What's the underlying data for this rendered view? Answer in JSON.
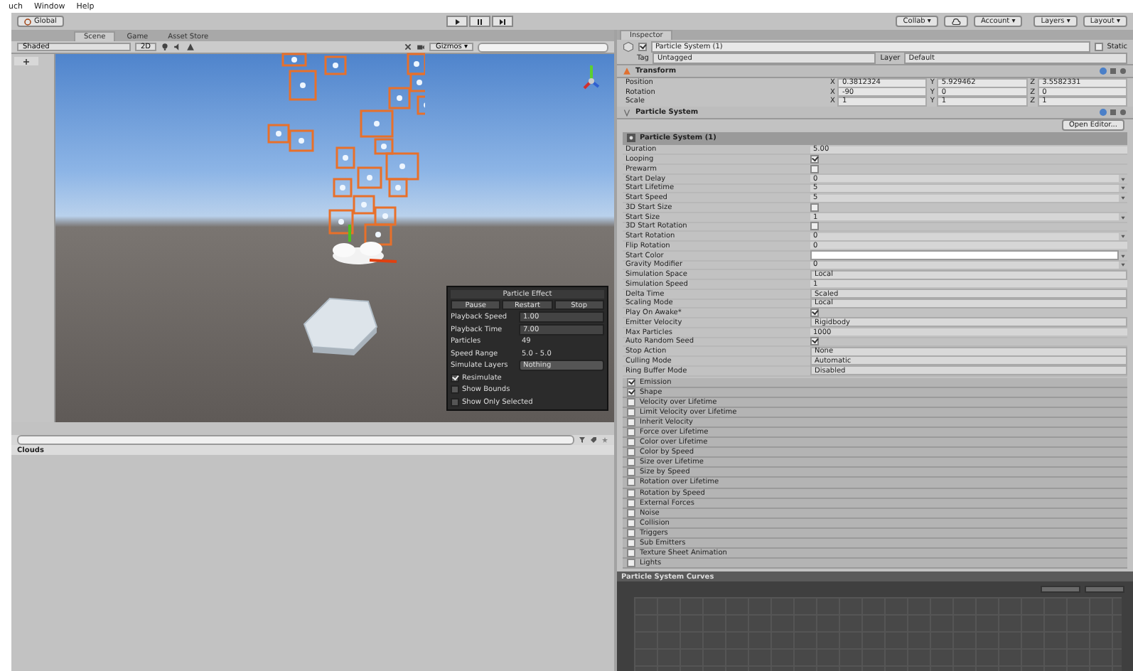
{
  "menu": [
    "uch",
    "Window",
    "Help"
  ],
  "toolbar": {
    "global": "Global",
    "play_buttons": [
      {
        "kind": "play",
        "selected": false
      },
      {
        "kind": "pause",
        "selected": false
      },
      {
        "kind": "step",
        "selected": false
      }
    ],
    "collab": "Collab ▾",
    "account": "Account ▾",
    "layers": "Layers ▾",
    "layout": "Layout ▾"
  },
  "scene_tabs": [
    {
      "label": "Scene",
      "selected": true
    },
    {
      "label": "Game",
      "selected": false
    },
    {
      "label": "Asset Store",
      "selected": false
    }
  ],
  "scene_toolbar": {
    "shading": "Shaded",
    "mode_2d": "2D",
    "gizmos": "Gizmos ▾"
  },
  "particle_effect": {
    "title": "Particle Effect",
    "buttons": [
      "Pause",
      "Restart",
      "Stop"
    ],
    "rows": [
      {
        "label": "Playback Speed",
        "value": "1.00",
        "kind": "field"
      },
      {
        "label": "Playback Time",
        "value": "7.00",
        "kind": "field"
      },
      {
        "label": "Particles",
        "value": "49",
        "kind": "text"
      },
      {
        "label": "Speed Range",
        "value": "5.0 - 5.0",
        "kind": "text"
      },
      {
        "label": "Simulate Layers",
        "value": "Nothing",
        "kind": "dropdown"
      }
    ],
    "checks": [
      {
        "label": "Resimulate",
        "checked": true
      },
      {
        "label": "Show Bounds",
        "checked": false
      },
      {
        "label": "Show Only Selected",
        "checked": false
      }
    ]
  },
  "project": {
    "folder": "Clouds"
  },
  "inspector": {
    "tab": "Inspector",
    "object": {
      "name": "Particle System (1)",
      "enabled": true,
      "static_label": "Static",
      "static": false,
      "tag_label": "Tag",
      "tag": "Untagged",
      "layer_label": "Layer",
      "layer": "Default"
    },
    "transform": {
      "title": "Transform",
      "rows": [
        {
          "label": "Position",
          "fields": [
            {
              "axis": "X",
              "value": "0.3812324"
            },
            {
              "axis": "Y",
              "value": "5.929462"
            },
            {
              "axis": "Z",
              "value": "3.5582331"
            }
          ]
        },
        {
          "label": "Rotation",
          "fields": [
            {
              "axis": "X",
              "value": "-90"
            },
            {
              "axis": "Y",
              "value": "0"
            },
            {
              "axis": "Z",
              "value": "0"
            }
          ]
        },
        {
          "label": "Scale",
          "fields": [
            {
              "axis": "X",
              "value": "1"
            },
            {
              "axis": "Y",
              "value": "1"
            },
            {
              "axis": "Z",
              "value": "1"
            }
          ]
        }
      ]
    },
    "particle_system": {
      "title": "Particle System",
      "open_editor": "Open Editor...",
      "module_title": "Particle System (1)",
      "properties": [
        {
          "label": "Duration",
          "kind": "value",
          "value": "5.00"
        },
        {
          "label": "Looping",
          "kind": "checkbox",
          "checked": true
        },
        {
          "label": "Prewarm",
          "kind": "checkbox",
          "checked": false
        },
        {
          "label": "Start Delay",
          "kind": "curve",
          "value": "0"
        },
        {
          "label": "Start Lifetime",
          "kind": "curve",
          "value": "5"
        },
        {
          "label": "Start Speed",
          "kind": "curve",
          "value": "5"
        },
        {
          "label": "3D Start Size",
          "kind": "checkbox",
          "checked": false
        },
        {
          "label": "Start Size",
          "kind": "curve",
          "value": "1"
        },
        {
          "label": "3D Start Rotation",
          "kind": "checkbox",
          "checked": false
        },
        {
          "label": "Start Rotation",
          "kind": "curve",
          "value": "0"
        },
        {
          "label": "Flip Rotation",
          "kind": "value",
          "value": "0"
        },
        {
          "label": "Start Color",
          "kind": "color",
          "color": "#ffffff"
        },
        {
          "label": "Gravity Modifier",
          "kind": "curve",
          "value": "0"
        },
        {
          "label": "Simulation Space",
          "kind": "dropdown",
          "value": "Local"
        },
        {
          "label": "Simulation Speed",
          "kind": "value",
          "value": "1"
        },
        {
          "label": "Delta Time",
          "kind": "dropdown",
          "value": "Scaled"
        },
        {
          "label": "Scaling Mode",
          "kind": "dropdown",
          "value": "Local"
        },
        {
          "label": "Play On Awake*",
          "kind": "checkbox",
          "checked": true
        },
        {
          "label": "Emitter Velocity",
          "kind": "dropdown",
          "value": "Rigidbody"
        },
        {
          "label": "Max Particles",
          "kind": "value",
          "value": "1000"
        },
        {
          "label": "Auto Random Seed",
          "kind": "checkbox",
          "checked": true
        },
        {
          "label": "Stop Action",
          "kind": "dropdown",
          "value": "None"
        },
        {
          "label": "Culling Mode",
          "kind": "dropdown",
          "value": "Automatic"
        },
        {
          "label": "Ring Buffer Mode",
          "kind": "dropdown",
          "value": "Disabled"
        }
      ],
      "modules": [
        {
          "label": "Emission",
          "checked": true
        },
        {
          "label": "Shape",
          "checked": true
        },
        {
          "label": "Velocity over Lifetime",
          "checked": false
        },
        {
          "label": "Limit Velocity over Lifetime",
          "checked": false
        },
        {
          "label": "Inherit Velocity",
          "checked": false
        },
        {
          "label": "Force over Lifetime",
          "checked": false
        },
        {
          "label": "Color over Lifetime",
          "checked": false
        },
        {
          "label": "Color by Speed",
          "checked": false
        },
        {
          "label": "Size over Lifetime",
          "checked": false
        },
        {
          "label": "Size by Speed",
          "checked": false
        },
        {
          "label": "Rotation over Lifetime",
          "checked": false
        },
        {
          "label": "Rotation by Speed",
          "checked": false
        },
        {
          "label": "External Forces",
          "checked": false
        },
        {
          "label": "Noise",
          "checked": false
        },
        {
          "label": "Collision",
          "checked": false
        },
        {
          "label": "Triggers",
          "checked": false
        },
        {
          "label": "Sub Emitters",
          "checked": false
        },
        {
          "label": "Texture Sheet Animation",
          "checked": false
        },
        {
          "label": "Lights",
          "checked": false
        }
      ]
    },
    "curves": {
      "title": "Particle System Curves"
    }
  }
}
